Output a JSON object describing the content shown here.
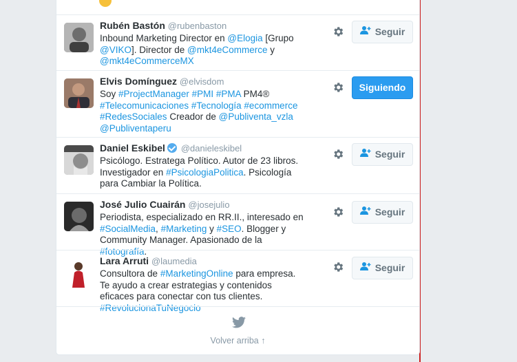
{
  "colors": {
    "link": "#1b95e0",
    "following_bg": "#2b9cf0",
    "frame": "#cc1f1f"
  },
  "users": [
    {
      "name": "Rubén Bastón",
      "handle": "@rubenbaston",
      "verified": false,
      "button": "Seguir",
      "bio": [
        [
          "Inbound Marketing Director en ",
          ""
        ],
        [
          "@Elogia",
          "lk"
        ],
        [
          " [Grupo ",
          ""
        ],
        [
          "@VIKO",
          "lk"
        ],
        [
          "]. Director de ",
          ""
        ],
        [
          "@mkt4eCommerce",
          "lk"
        ],
        [
          " y ",
          ""
        ],
        [
          "@mkt4eCommerceMX",
          "lk"
        ]
      ]
    },
    {
      "name": "Elvis Domínguez",
      "handle": "@elvisdom",
      "verified": false,
      "button": "Siguiendo",
      "bio": [
        [
          "Soy ",
          ""
        ],
        [
          "#ProjectManager",
          "lk"
        ],
        [
          " ",
          ""
        ],
        [
          "#PMI",
          "lk"
        ],
        [
          " ",
          ""
        ],
        [
          "#PMA",
          "lk"
        ],
        [
          " PM4® ",
          ""
        ],
        [
          "#Telecomunicaciones",
          "lk"
        ],
        [
          " ",
          ""
        ],
        [
          "#Tecnología",
          "lk"
        ],
        [
          " ",
          ""
        ],
        [
          "#ecommerce",
          "lk"
        ],
        [
          " ",
          ""
        ],
        [
          "#RedesSociales",
          "lk"
        ],
        [
          " Creador de ",
          ""
        ],
        [
          "@Publiventa_vzla",
          "lk"
        ],
        [
          " ",
          ""
        ],
        [
          "@Publiventaperu",
          "lk"
        ]
      ]
    },
    {
      "name": "Daniel Eskibel",
      "handle": "@danieleskibel",
      "verified": true,
      "button": "Seguir",
      "bio": [
        [
          "Psicólogo. Estratega Político. Autor de 23 libros. Investigador en ",
          ""
        ],
        [
          "#PsicologiaPolitica",
          "lk"
        ],
        [
          ". Psicología para Cambiar la Política.",
          ""
        ]
      ]
    },
    {
      "name": "José Julio Cuairán",
      "handle": "@josejulio",
      "verified": false,
      "button": "Seguir",
      "bio": [
        [
          "Periodista, especializado en RR.II., interesado en ",
          ""
        ],
        [
          "#SocialMedia",
          "lk"
        ],
        [
          ", ",
          ""
        ],
        [
          "#Marketing",
          "lk"
        ],
        [
          " y ",
          ""
        ],
        [
          "#SEO",
          "lk"
        ],
        [
          ". Blogger y Community Manager. Apasionado de la ",
          ""
        ],
        [
          "#fotografía",
          "lk"
        ],
        [
          ".",
          ""
        ]
      ]
    },
    {
      "name": "Lara Arruti",
      "handle": "@laumedia",
      "verified": false,
      "button": "Seguir",
      "bio": [
        [
          "Consultora de ",
          ""
        ],
        [
          "#MarketingOnline",
          "lk"
        ],
        [
          " para empresa. Te ayudo a crear estrategias y contenidos eficaces para conectar con tus clientes. ",
          ""
        ],
        [
          "#RevolucionaTuNegocio",
          "lk"
        ]
      ]
    }
  ],
  "footer": {
    "back_to_top": "Volver arriba ↑",
    "icon": "twitter-bird-icon"
  }
}
